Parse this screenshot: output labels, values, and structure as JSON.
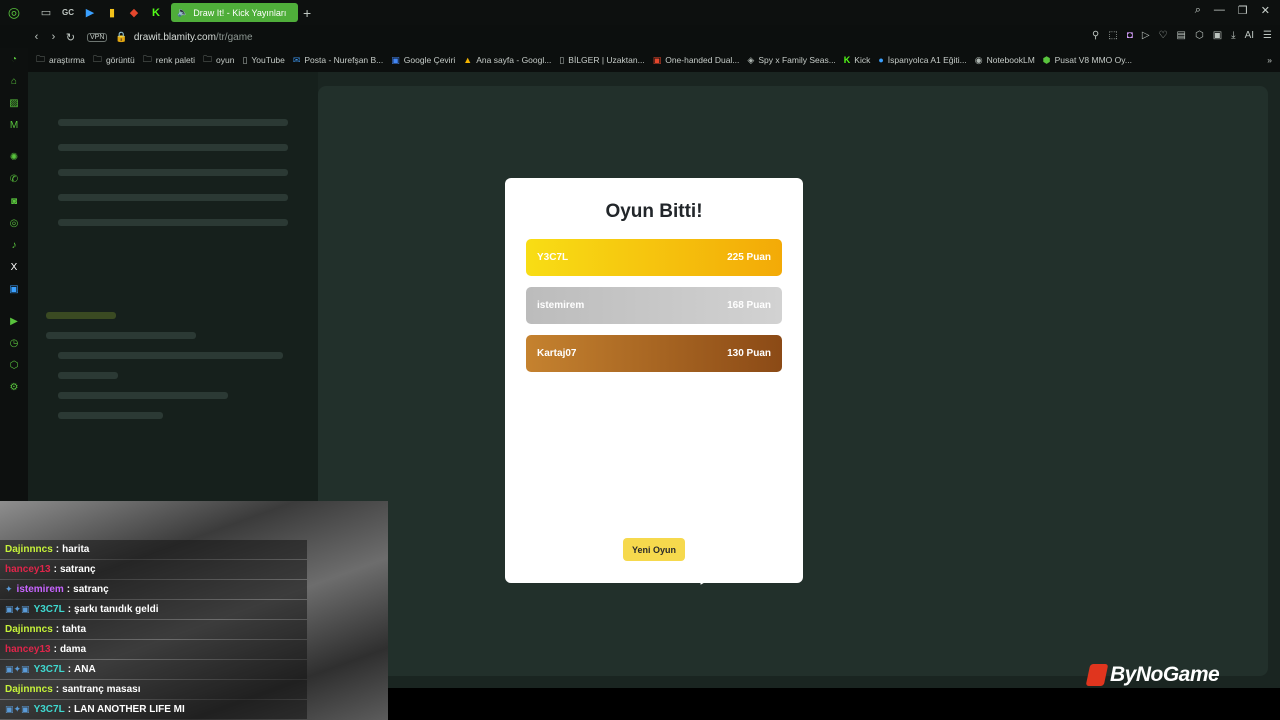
{
  "browser": {
    "active_tab_title": "Draw It! - Kick Yayınları",
    "new_tab_label": "+",
    "tab_shortcuts": [
      "GC"
    ],
    "url_domain": "drawit.blamity.com",
    "url_path": "/tr/game",
    "vpn_label": "VPN",
    "ai_label": "AI"
  },
  "bookmarks": [
    {
      "label": "araştırma",
      "icon": "folder-icon"
    },
    {
      "label": "görüntü",
      "icon": "folder-icon"
    },
    {
      "label": "renk paleti",
      "icon": "folder-icon"
    },
    {
      "label": "oyun",
      "icon": "folder-icon"
    },
    {
      "label": "YouTube",
      "icon": "page-icon"
    },
    {
      "label": "Posta - Nurefşan B...",
      "icon": "mail-icon"
    },
    {
      "label": "Google Çeviri",
      "icon": "translate-icon"
    },
    {
      "label": "Ana sayfa - Googl...",
      "icon": "drive-icon"
    },
    {
      "label": "BİLGER | Uzaktan...",
      "icon": "page-icon"
    },
    {
      "label": "One-handed Dual...",
      "icon": "game-icon"
    },
    {
      "label": "Spy x Family Seas...",
      "icon": "spy-icon"
    },
    {
      "label": "Kick",
      "icon": "kick-icon"
    },
    {
      "label": "İspanyolca A1 Eğiti...",
      "icon": "globe-icon"
    },
    {
      "label": "NotebookLM",
      "icon": "notebook-icon"
    },
    {
      "label": "Pusat V8 MMO Oy...",
      "icon": "game-icon"
    }
  ],
  "modal": {
    "title": "Oyun Bitti!",
    "results": [
      {
        "name": "Y3C7L",
        "score": "225 Puan"
      },
      {
        "name": "istemirem",
        "score": "168 Puan"
      },
      {
        "name": "Kartaj07",
        "score": "130 Puan"
      }
    ],
    "new_game_label": "Yeni Oyun"
  },
  "chat": [
    {
      "user": "Dajinnncs",
      "message": "harita",
      "color": "#c6f23a",
      "badges": ""
    },
    {
      "user": "hancey13",
      "message": "satranç",
      "color": "#e0254a",
      "badges": ""
    },
    {
      "user": "istemirem",
      "message": "satranç",
      "color": "#c764ff",
      "badges": "✦"
    },
    {
      "user": "Y3C7L",
      "message": "şarkı tanıdık geldi",
      "color": "#3fd9d0",
      "badges": "▣✦▣"
    },
    {
      "user": "Dajinnncs",
      "message": "tahta",
      "color": "#c6f23a",
      "badges": ""
    },
    {
      "user": "hancey13",
      "message": "dama",
      "color": "#e0254a",
      "badges": ""
    },
    {
      "user": "Y3C7L",
      "message": "ANA",
      "color": "#3fd9d0",
      "badges": "▣✦▣"
    },
    {
      "user": "Dajinnncs",
      "message": "santranç masası",
      "color": "#c6f23a",
      "badges": ""
    },
    {
      "user": "Y3C7L",
      "message": "LAN ANOTHER LIFE MI",
      "color": "#3fd9d0",
      "badges": "▣✦▣"
    }
  ],
  "watermark": {
    "text": "ByNoGame"
  },
  "colors": {
    "accent": "#4fae3a",
    "gold": "#f3c10c",
    "silver": "#c4c4c4",
    "bronze": "#a8632a",
    "button": "#f6d94d"
  }
}
